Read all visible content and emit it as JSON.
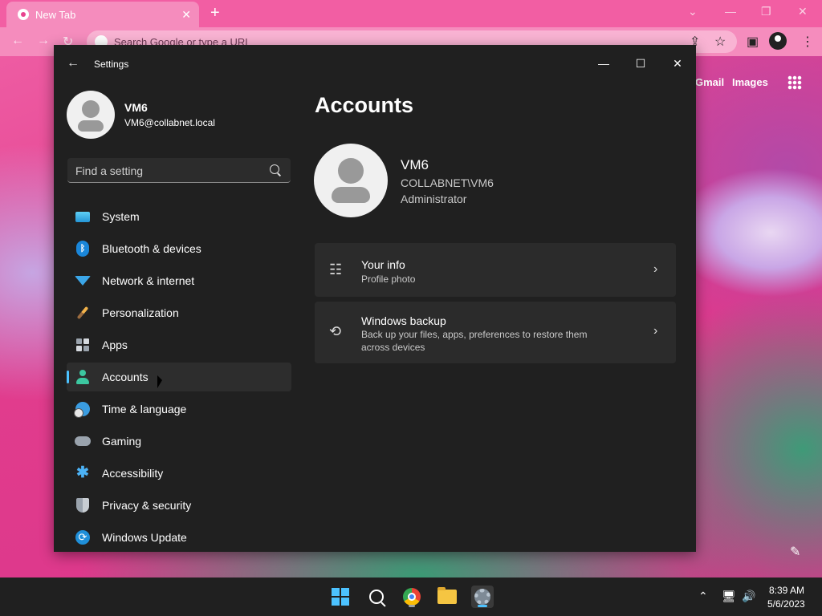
{
  "browser": {
    "tab_title": "New Tab",
    "omnibox_placeholder": "Search Google or type a URL",
    "links": {
      "gmail": "Gmail",
      "images": "Images"
    }
  },
  "settings": {
    "app_title": "Settings",
    "user": {
      "name": "VM6",
      "email": "VM6@collabnet.local"
    },
    "search_placeholder": "Find a setting",
    "nav": [
      {
        "label": "System",
        "icon": "display-icon"
      },
      {
        "label": "Bluetooth & devices",
        "icon": "bluetooth-icon"
      },
      {
        "label": "Network & internet",
        "icon": "wifi-icon"
      },
      {
        "label": "Personalization",
        "icon": "paintbrush-icon"
      },
      {
        "label": "Apps",
        "icon": "apps-icon"
      },
      {
        "label": "Accounts",
        "icon": "person-icon",
        "selected": true
      },
      {
        "label": "Time & language",
        "icon": "globe-clock-icon"
      },
      {
        "label": "Gaming",
        "icon": "gamepad-icon"
      },
      {
        "label": "Accessibility",
        "icon": "accessibility-icon"
      },
      {
        "label": "Privacy & security",
        "icon": "shield-icon"
      },
      {
        "label": "Windows Update",
        "icon": "update-icon"
      }
    ],
    "page_title": "Accounts",
    "account": {
      "name": "VM6",
      "domain": "COLLABNET\\VM6",
      "role": "Administrator"
    },
    "cards": [
      {
        "title": "Your info",
        "subtitle": "Profile photo",
        "icon": "person-card-icon"
      },
      {
        "title": "Windows backup",
        "subtitle": "Back up your files, apps, preferences to restore them across devices",
        "icon": "backup-sync-icon"
      }
    ],
    "accent": "#4cc2ff"
  },
  "taskbar": {
    "time": "8:39 AM",
    "date": "5/6/2023"
  }
}
